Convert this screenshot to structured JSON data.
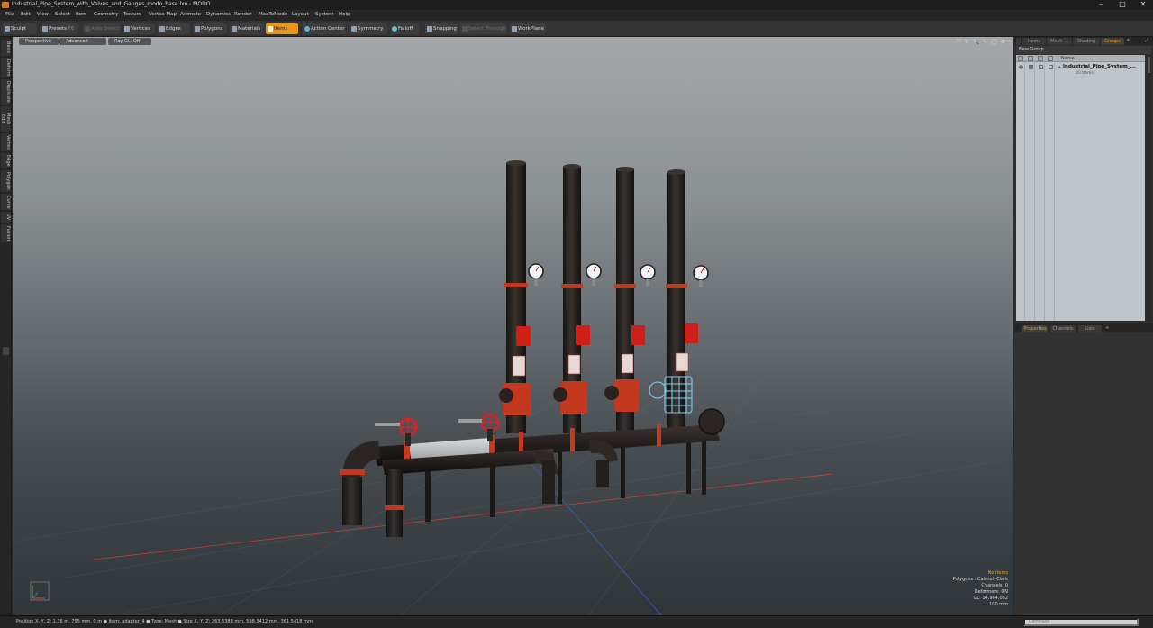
{
  "window": {
    "title": "Industrial_Pipe_System_with_Valves_and_Gauges_modo_base.lxo - MODO",
    "minimize": "–",
    "maximize": "□",
    "close": "✕"
  },
  "menu": [
    "File",
    "Edit",
    "View",
    "Select",
    "Item",
    "Geometry",
    "Texture",
    "Vertex Map",
    "Animate",
    "Dynamics",
    "Render",
    "MaxToModo",
    "Layout",
    "System",
    "Help"
  ],
  "toolbar": {
    "sculpt": "Sculpt",
    "presets": "Presets",
    "presets_key": "F6",
    "auto_select": "Auto Select",
    "vertices": "Vertices",
    "edges": "Edges",
    "polygons": "Polygons",
    "materials": "Materials",
    "items": "Items",
    "action_center": "Action Center",
    "symmetry": "Symmetry",
    "falloff": "Falloff",
    "snapping": "Snapping",
    "select_through": "Select Through",
    "workplane": "WorkPlane"
  },
  "left_tabs": [
    "Basic",
    "Deform",
    "Duplicate",
    "Mesh Edit",
    "Vertex",
    "Edge",
    "Polygon",
    "Curve",
    "UV",
    "Fusion"
  ],
  "viewport": {
    "view_mode": "Perspective",
    "shading": "Advanced",
    "ray_gl": "Ray GL: Off",
    "icons": "⤧ ↻ 🔍 ✎ ◯ ⚙",
    "info": {
      "selection": "No Items",
      "polygons": "Polygons : Catmull-Clark",
      "channels": "Channels: 0",
      "deformers": "Deformers: ON",
      "gl": "GL: 14,964,032",
      "grid": "100 mm"
    }
  },
  "right_panel": {
    "tabs": [
      "Items",
      "Mesh ...",
      "Shading",
      "Groups"
    ],
    "active_tab": "Groups",
    "new_group": "New Group",
    "list_header_name": "Name",
    "group_name": "Industrial_Pipe_System_...",
    "group_count": "20 Items",
    "lower_tabs": [
      "Properties",
      "Channels",
      "Lists"
    ],
    "lower_active": "Properties"
  },
  "status": {
    "text": "Position X, Y, Z:   1.36 m, 755 mm, 0 m  ●  Item:  adapter_4  ●  Type:  Mesh  ●  Size X, Y, Z:   263.6388 mm, 598.3412 mm, 361.5418 mm",
    "command_placeholder": "Command"
  },
  "colors": {
    "accent": "#e8951c",
    "pipe": "#2a2624",
    "flange_red": "#c2391f",
    "selection_wire": "#7fd3f5"
  }
}
